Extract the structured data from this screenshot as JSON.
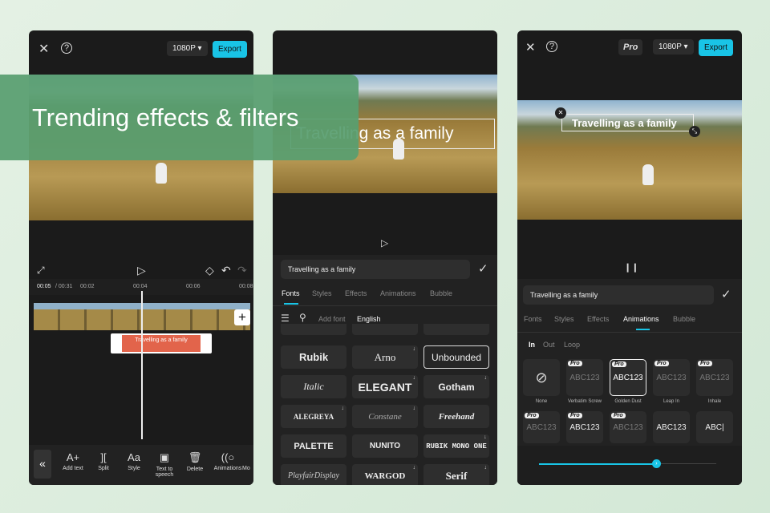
{
  "banner": {
    "title": "Trending effects & filters"
  },
  "left": {
    "resolution": "1080P ▾",
    "export": "Export",
    "time_current": "00:05",
    "time_total": "/ 00:31",
    "ticks": [
      "00:02",
      "00:04",
      "00:06",
      "00:08"
    ],
    "clip_text": "Travelling as a family",
    "tools": [
      {
        "icon": "«",
        "label": ""
      },
      {
        "icon": "A+",
        "label": "Add text"
      },
      {
        "icon": "][",
        "label": "Split"
      },
      {
        "icon": "Aa",
        "label": "Style"
      },
      {
        "icon": "▣",
        "label": "Text to speech"
      },
      {
        "icon": "🗑",
        "label": "Delete"
      },
      {
        "icon": "((○",
        "label": "Animations"
      },
      {
        "icon": "",
        "label": "Mo"
      }
    ]
  },
  "middle": {
    "overlay_text": "Travelling as a family",
    "text_field": "Travelling as a family",
    "tabs": [
      "Fonts",
      "Styles",
      "Effects",
      "Animations",
      "Bubble"
    ],
    "active_tab": "Fonts",
    "add_font": "Add font",
    "language": "English",
    "fonts": [
      "Rubik",
      "Arno",
      "Unbounded",
      "Italic",
      "ELEGANT",
      "Gotham",
      "ALEGREYA",
      "Constane",
      "Freehand",
      "PALETTE",
      "NUNITO",
      "RUBIK MONO ONE",
      "PlayfairDisplay",
      "WARGOD",
      "Serif"
    ],
    "selected_font": "Unbounded"
  },
  "right": {
    "pro": "Pro",
    "resolution": "1080P ▾",
    "export": "Export",
    "overlay_text": "Travelling as a family",
    "text_field": "Travelling as a family",
    "tabs": [
      "Fonts",
      "Styles",
      "Effects",
      "Animations",
      "Bubble"
    ],
    "active_tab": "Animations",
    "subtabs": [
      "In",
      "Out",
      "Loop"
    ],
    "animations": [
      {
        "label": "None",
        "text": "⊘",
        "pro": false
      },
      {
        "label": "Verbatim Screw",
        "text": "ABC123",
        "pro": true
      },
      {
        "label": "Golden Dust",
        "text": "ABC123",
        "pro": true
      },
      {
        "label": "Leap In",
        "text": "ABC123",
        "pro": true
      },
      {
        "label": "Inhale",
        "text": "ABC123",
        "pro": true
      },
      {
        "label": "",
        "text": "ABC123",
        "pro": true
      },
      {
        "label": "",
        "text": "ABC123",
        "pro": true
      },
      {
        "label": "",
        "text": "ABC123",
        "pro": true
      },
      {
        "label": "",
        "text": "ABC123",
        "pro": false
      },
      {
        "label": "",
        "text": "ABC|",
        "pro": false
      }
    ],
    "pro_badge": "Pro",
    "duration_slider": 0.66,
    "accent": "#19c4e6"
  }
}
